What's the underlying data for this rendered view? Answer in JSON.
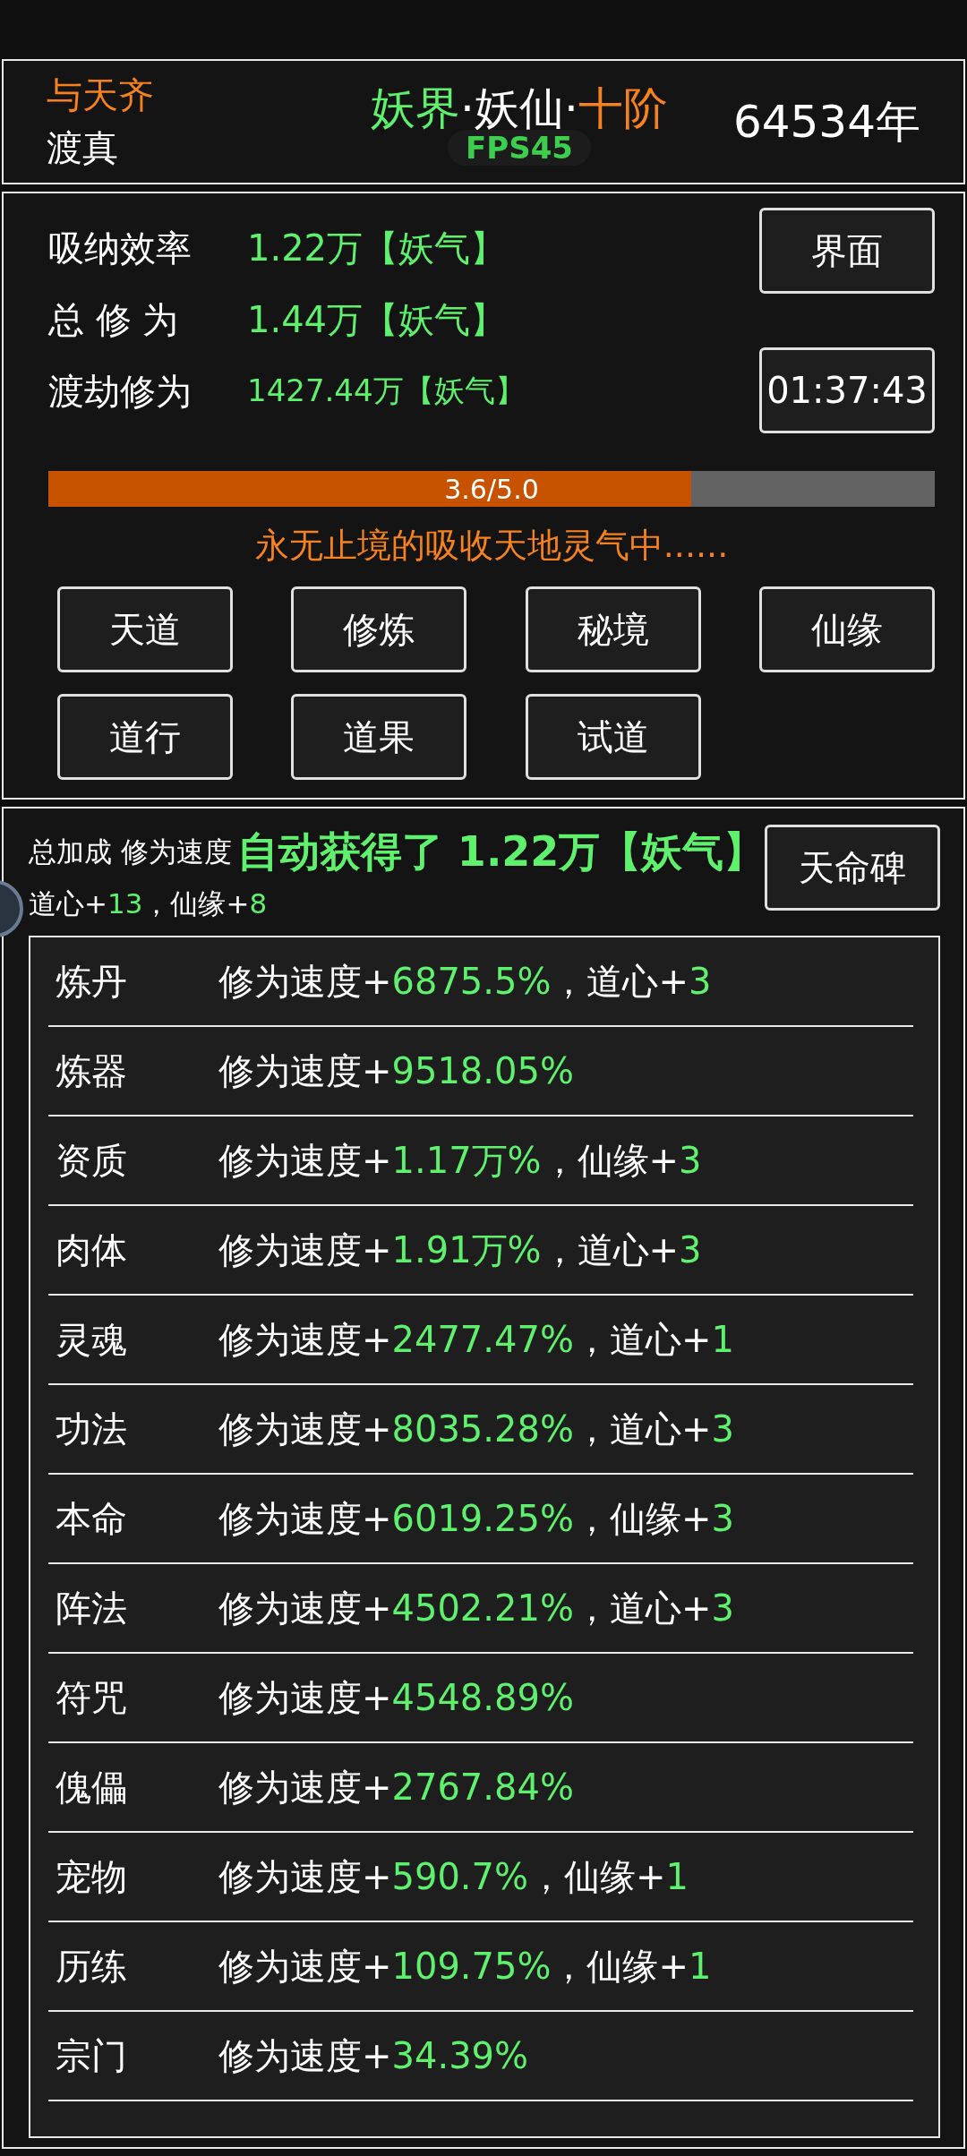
{
  "header": {
    "title": "与天齐",
    "subtitle": "渡真",
    "realm": [
      {
        "text": "妖界",
        "kind": "green"
      },
      {
        "text": "·妖仙·",
        "kind": "white"
      },
      {
        "text": "十阶",
        "kind": "orange"
      }
    ],
    "fps": "FPS45",
    "years": "64534年"
  },
  "stats": [
    {
      "label": "吸纳效率",
      "value": "1.22万【妖气】",
      "kind": "large"
    },
    {
      "label": "总 修 为",
      "value": "1.44万【妖气】",
      "kind": "large"
    },
    {
      "label": "渡劫修为",
      "value": "1427.44万【妖气】",
      "kind": "small"
    }
  ],
  "interface_button": "界面",
  "timer": "01:37:43",
  "progress": {
    "level": 0.725,
    "label": "3.6/5.0"
  },
  "status_text": "永无止境的吸收天地灵气中......",
  "actions": [
    "天道",
    "修炼",
    "秘境",
    "仙缘",
    "道行",
    "道果",
    "试道"
  ],
  "bonus": {
    "label": "总加成 修为速度",
    "toast": "自动获得了 1.22万【妖气】",
    "parts": [
      {
        "text": "道心+",
        "kind": "label"
      },
      {
        "text": "13",
        "kind": "value"
      },
      {
        "text": "，仙缘+",
        "kind": "label"
      },
      {
        "text": "8",
        "kind": "value"
      }
    ],
    "button": "天命碑"
  },
  "rows": [
    {
      "name": "炼丹",
      "parts": [
        {
          "text": "修为速度+",
          "kind": "label"
        },
        {
          "text": "6875.5%",
          "kind": "value"
        },
        {
          "text": "，道心+",
          "kind": "label"
        },
        {
          "text": "3",
          "kind": "value"
        }
      ]
    },
    {
      "name": "炼器",
      "parts": [
        {
          "text": "修为速度+",
          "kind": "label"
        },
        {
          "text": "9518.05%",
          "kind": "value"
        }
      ]
    },
    {
      "name": "资质",
      "parts": [
        {
          "text": "修为速度+",
          "kind": "label"
        },
        {
          "text": "1.17万%",
          "kind": "value"
        },
        {
          "text": "，仙缘+",
          "kind": "label"
        },
        {
          "text": "3",
          "kind": "value"
        }
      ]
    },
    {
      "name": "肉体",
      "parts": [
        {
          "text": "修为速度+",
          "kind": "label"
        },
        {
          "text": "1.91万%",
          "kind": "value"
        },
        {
          "text": "，道心+",
          "kind": "label"
        },
        {
          "text": "3",
          "kind": "value"
        }
      ]
    },
    {
      "name": "灵魂",
      "parts": [
        {
          "text": "修为速度+",
          "kind": "label"
        },
        {
          "text": "2477.47%",
          "kind": "value"
        },
        {
          "text": "，道心+",
          "kind": "label"
        },
        {
          "text": "1",
          "kind": "value"
        }
      ]
    },
    {
      "name": "功法",
      "parts": [
        {
          "text": "修为速度+",
          "kind": "label"
        },
        {
          "text": "8035.28%",
          "kind": "value"
        },
        {
          "text": "，道心+",
          "kind": "label"
        },
        {
          "text": "3",
          "kind": "value"
        }
      ]
    },
    {
      "name": "本命",
      "parts": [
        {
          "text": "修为速度+",
          "kind": "label"
        },
        {
          "text": "6019.25%",
          "kind": "value"
        },
        {
          "text": "，仙缘+",
          "kind": "label"
        },
        {
          "text": "3",
          "kind": "value"
        }
      ]
    },
    {
      "name": "阵法",
      "parts": [
        {
          "text": "修为速度+",
          "kind": "label"
        },
        {
          "text": "4502.21%",
          "kind": "value"
        },
        {
          "text": "，道心+",
          "kind": "label"
        },
        {
          "text": "3",
          "kind": "value"
        }
      ]
    },
    {
      "name": "符咒",
      "parts": [
        {
          "text": "修为速度+",
          "kind": "label"
        },
        {
          "text": "4548.89%",
          "kind": "value"
        }
      ]
    },
    {
      "name": "傀儡",
      "parts": [
        {
          "text": "修为速度+",
          "kind": "label"
        },
        {
          "text": "2767.84%",
          "kind": "value"
        }
      ]
    },
    {
      "name": "宠物",
      "parts": [
        {
          "text": "修为速度+",
          "kind": "label"
        },
        {
          "text": "590.7%",
          "kind": "value"
        },
        {
          "text": "，仙缘+",
          "kind": "label"
        },
        {
          "text": "1",
          "kind": "value"
        }
      ]
    },
    {
      "name": "历练",
      "parts": [
        {
          "text": "修为速度+",
          "kind": "label"
        },
        {
          "text": "109.75%",
          "kind": "value"
        },
        {
          "text": "，仙缘+",
          "kind": "label"
        },
        {
          "text": "1",
          "kind": "value"
        }
      ]
    },
    {
      "name": "宗门",
      "parts": [
        {
          "text": "修为速度+",
          "kind": "label"
        },
        {
          "text": "34.39%",
          "kind": "value"
        }
      ]
    }
  ]
}
